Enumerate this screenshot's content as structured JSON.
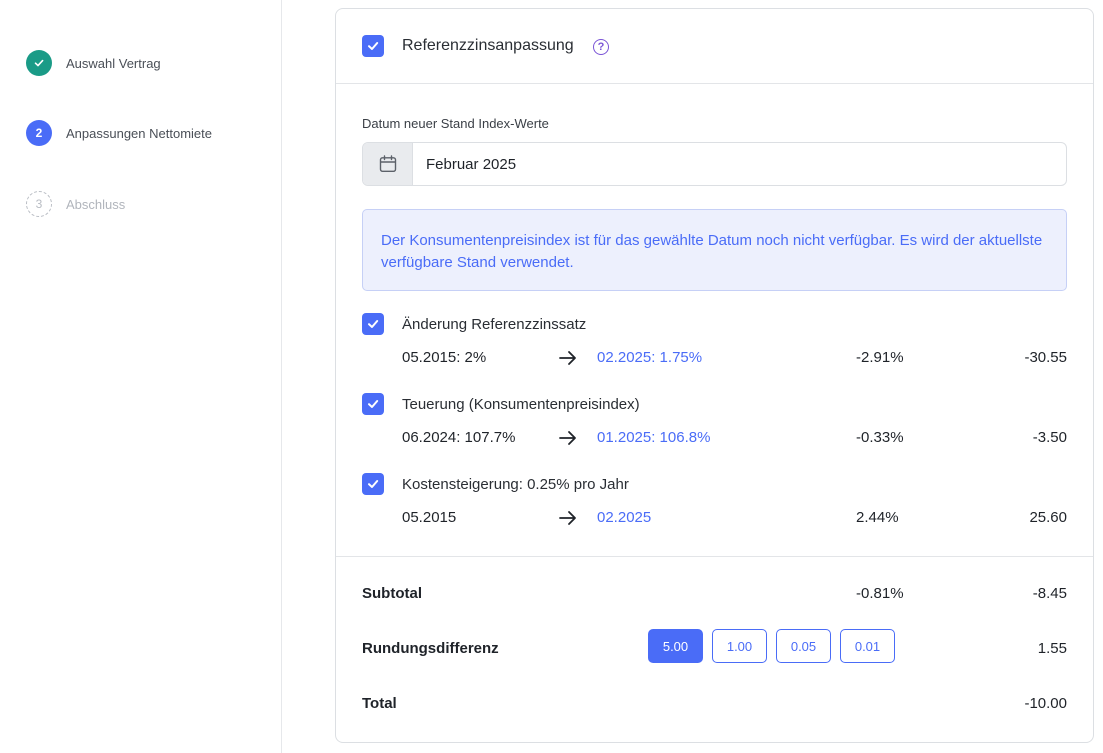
{
  "steps": [
    {
      "number": "✓",
      "label": "Auswahl Vertrag",
      "state": "done"
    },
    {
      "number": "2",
      "label": "Anpassungen Nettomiete",
      "state": "active"
    },
    {
      "number": "3",
      "label": "Abschluss",
      "state": "pending"
    }
  ],
  "card": {
    "header_title": "Referenzzinsanpassung",
    "help_glyph": "?",
    "date_label": "Datum neuer Stand Index-Werte",
    "date_value": "Februar 2025",
    "info_text": "Der Konsumentenpreisindex ist für das gewählte Datum noch nicht verfügbar. Es wird der aktuellste verfügbare Stand verwendet.",
    "items": [
      {
        "title": "Änderung Referenzzinssatz",
        "from": "05.2015: 2%",
        "to": "02.2025: 1.75%",
        "pct": "-2.91%",
        "amount": "-30.55",
        "checked": true
      },
      {
        "title": "Teuerung (Konsumentenpreisindex)",
        "from": "06.2024: 107.7%",
        "to": "01.2025: 106.8%",
        "pct": "-0.33%",
        "amount": "-3.50",
        "checked": true
      },
      {
        "title": "Kostensteigerung: 0.25% pro Jahr",
        "from": "05.2015",
        "to": "02.2025",
        "pct": "2.44%",
        "amount": "25.60",
        "checked": true
      }
    ],
    "subtotal": {
      "label": "Subtotal",
      "pct": "-0.81%",
      "amount": "-8.45"
    },
    "rounding": {
      "label": "Rundungsdifferenz",
      "options": [
        "5.00",
        "1.00",
        "0.05",
        "0.01"
      ],
      "selected": "5.00",
      "amount": "1.55"
    },
    "total": {
      "label": "Total",
      "amount": "-10.00"
    }
  },
  "colors": {
    "accent": "#4a6cf7",
    "done": "#1a9b87",
    "help": "#7b55d6"
  },
  "icons": {
    "calendar": "calendar-icon",
    "arrow": "arrow-right-icon",
    "check": "check-icon",
    "help": "question-circle-icon"
  }
}
